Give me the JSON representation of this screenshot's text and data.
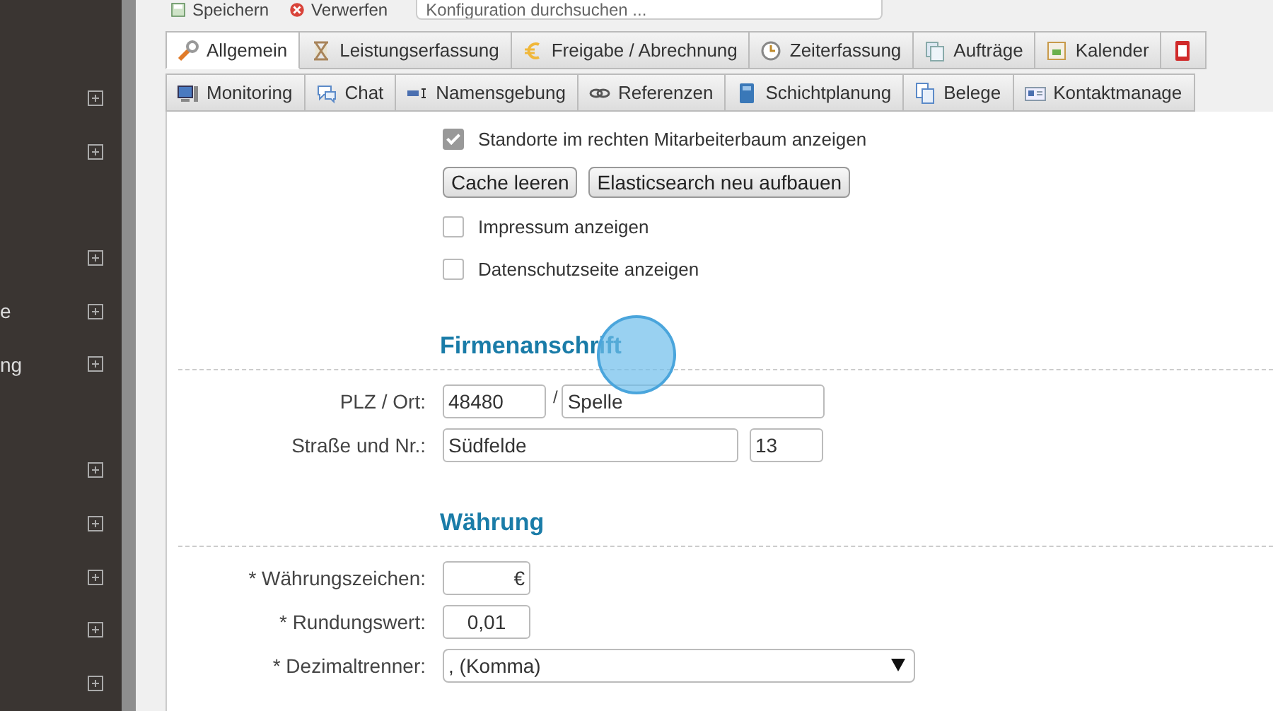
{
  "toolbar": {
    "buttons": [
      {
        "label": "Speichern"
      },
      {
        "label": "Verwerfen"
      }
    ],
    "search": {
      "placeholder": "Konfiguration durchsuchen ..."
    }
  },
  "sidebar": {
    "items": [
      {
        "expanded": false
      },
      {
        "expanded": false
      },
      {
        "expanded": false
      },
      {
        "label": "e",
        "expanded": false
      },
      {
        "label": "ng",
        "expanded": false
      },
      {
        "expanded": false
      },
      {
        "expanded": false
      },
      {
        "expanded": false
      },
      {
        "expanded": false
      },
      {
        "expanded": false
      }
    ]
  },
  "tab_rows": [
    {
      "tabs": [
        {
          "label": "Allgemein",
          "selected": true
        },
        {
          "label": "Leistungserfassung",
          "selected": false
        },
        {
          "label": "Freigabe / Abrechnung",
          "selected": false
        },
        {
          "label": "Zeiterfassung",
          "selected": false
        },
        {
          "label": "Aufträge",
          "selected": false
        },
        {
          "label": "Kalender",
          "selected": false
        },
        {
          "selected": false
        }
      ]
    },
    {
      "tabs": [
        {
          "label": "Monitoring",
          "selected": false
        },
        {
          "label": "Chat",
          "selected": false
        },
        {
          "label": "Namensgebung",
          "selected": false
        },
        {
          "label": "Referenzen",
          "selected": false
        },
        {
          "label": "Schichtplanung",
          "selected": false
        },
        {
          "label": "Belege",
          "selected": false
        },
        {
          "label": "Kontaktmanage",
          "selected": false
        }
      ]
    }
  ],
  "options": [
    {
      "kind": "checkbox",
      "label": "Standorte im rechten Mitarbeiterbaum anzeigen",
      "checked": true
    },
    {
      "kind": "buttons",
      "buttons": [
        "Cache leeren",
        "Elasticsearch neu aufbauen"
      ]
    },
    {
      "kind": "checkbox",
      "label": "Impressum anzeigen",
      "checked": false
    },
    {
      "kind": "checkbox",
      "label": "Datenschutzseite anzeigen",
      "checked": false
    }
  ],
  "sections": [
    {
      "title": "Firmenanschrift",
      "fields": [
        {
          "label": "PLZ / Ort:",
          "inputs": [
            {
              "kind": "zip",
              "value": "48480"
            },
            {
              "kind": "separator",
              "value": "/"
            },
            {
              "kind": "city",
              "value": "Spelle"
            }
          ]
        },
        {
          "label": "Straße und Nr.:",
          "inputs": [
            {
              "kind": "street",
              "value": "Südfelde"
            },
            {
              "kind": "number",
              "value": "13"
            }
          ]
        }
      ]
    },
    {
      "title": "Währung",
      "fields": [
        {
          "label": "* Währungszeichen:",
          "inputs": [
            {
              "kind": "symbol",
              "value": "€"
            }
          ]
        },
        {
          "label": "* Rundungswert:",
          "inputs": [
            {
              "kind": "rounding",
              "value": "0,01"
            }
          ]
        },
        {
          "label": "* Dezimaltrenner:",
          "inputs": [
            {
              "kind": "select",
              "value": ", (Komma)"
            }
          ]
        }
      ]
    }
  ]
}
